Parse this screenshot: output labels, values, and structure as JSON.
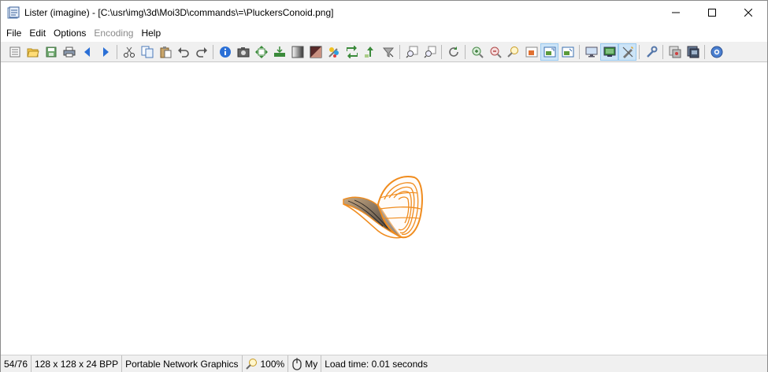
{
  "window": {
    "title": "Lister (imagine) - [C:\\usr\\img\\3d\\Moi3D\\commands\\=\\PluckersConoid.png]"
  },
  "menu": [
    {
      "label": "File",
      "enabled": true
    },
    {
      "label": "Edit",
      "enabled": true
    },
    {
      "label": "Options",
      "enabled": true
    },
    {
      "label": "Encoding",
      "enabled": false
    },
    {
      "label": "Help",
      "enabled": true
    }
  ],
  "toolbar": {
    "icons": [
      "properties-icon",
      "open-icon",
      "save-icon",
      "print-icon",
      "back-icon",
      "forward-icon",
      "cut-icon",
      "copy-icon",
      "paste-icon",
      "undo-icon",
      "redo-icon",
      "info-icon",
      "capture-icon",
      "resize-icon",
      "print-icon-2",
      "gradient-icon",
      "adjust-colors-icon",
      "effects-icon",
      "rotate-icon",
      "flip-icon",
      "filter-icon",
      "zoom-window-icon",
      "zoom-area-icon",
      "refresh-icon",
      "zoom-in-icon",
      "zoom-out-icon",
      "zoom-tool-icon",
      "fit-icon",
      "fit-large-icon",
      "fit-window-icon",
      "fullscreen-icon",
      "view-mode-icon",
      "edit-tool-icon",
      "settings-icon",
      "plugin-icon",
      "batch-icon",
      "help-icon"
    ]
  },
  "image": {
    "description": ""
  },
  "status": {
    "position": "54/76",
    "dimensions": "128 x 128 x 24 BPP",
    "format": "Portable Network Graphics",
    "zoom": "100%",
    "mode": "My",
    "load_time": "Load time: 0.01 seconds"
  },
  "colors": {
    "accent_orange": "#f08c1e",
    "toolbar_bg": "#f0f0f0",
    "pressed_bg": "#cce4f7"
  }
}
